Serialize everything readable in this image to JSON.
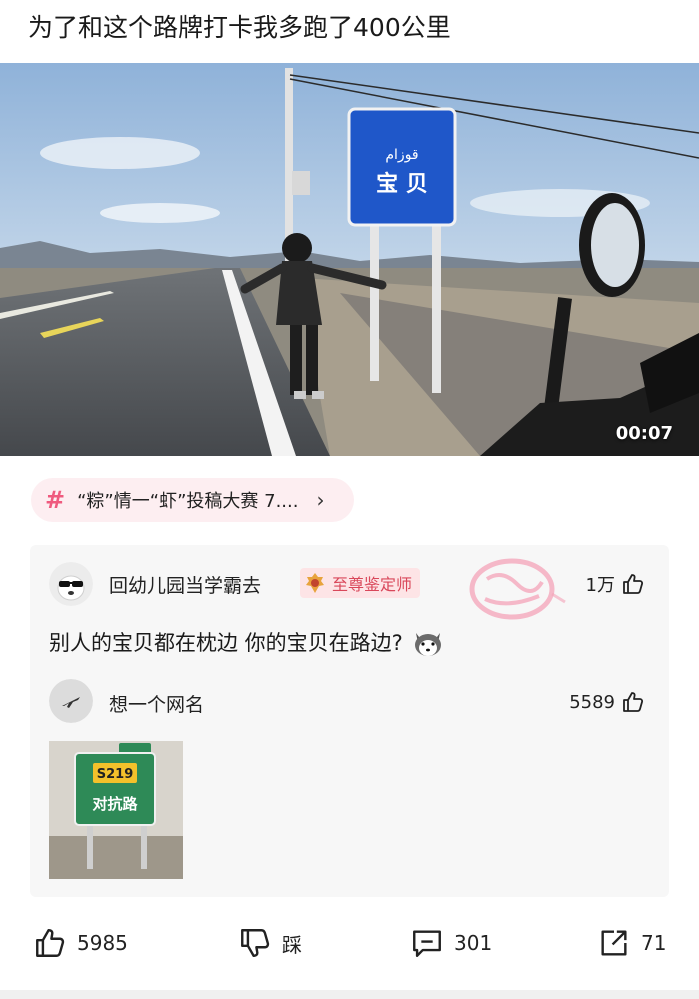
{
  "post": {
    "title": "为了和这个路牌打卡我多跑了400公里",
    "video_duration": "00:07",
    "sign_text_top": "قوزام",
    "sign_text_main": "宝 贝"
  },
  "topic": {
    "label": "“粽”情一“虾”投稿大赛 7...."
  },
  "comment": {
    "username": "回幼儿园当学霸去",
    "badge": "至尊鉴定师",
    "likes": "1万",
    "text": "别人的宝贝都在枕边 你的宝贝在路边?"
  },
  "reply": {
    "username": "想一个网名",
    "likes": "5589",
    "sign_code": "S219",
    "sign_main": "对抗路"
  },
  "bottom_bar": {
    "like_count": "5985",
    "dislike_label": "踩",
    "comment_count": "301",
    "share_count": "71"
  },
  "colors": {
    "topic_accent": "#ef5a7e",
    "topic_bg": "#fdeef1",
    "badge_text": "#d9475a",
    "road_sign_blue": "#1f57c9",
    "road_sign_green": "#2e8a57"
  }
}
